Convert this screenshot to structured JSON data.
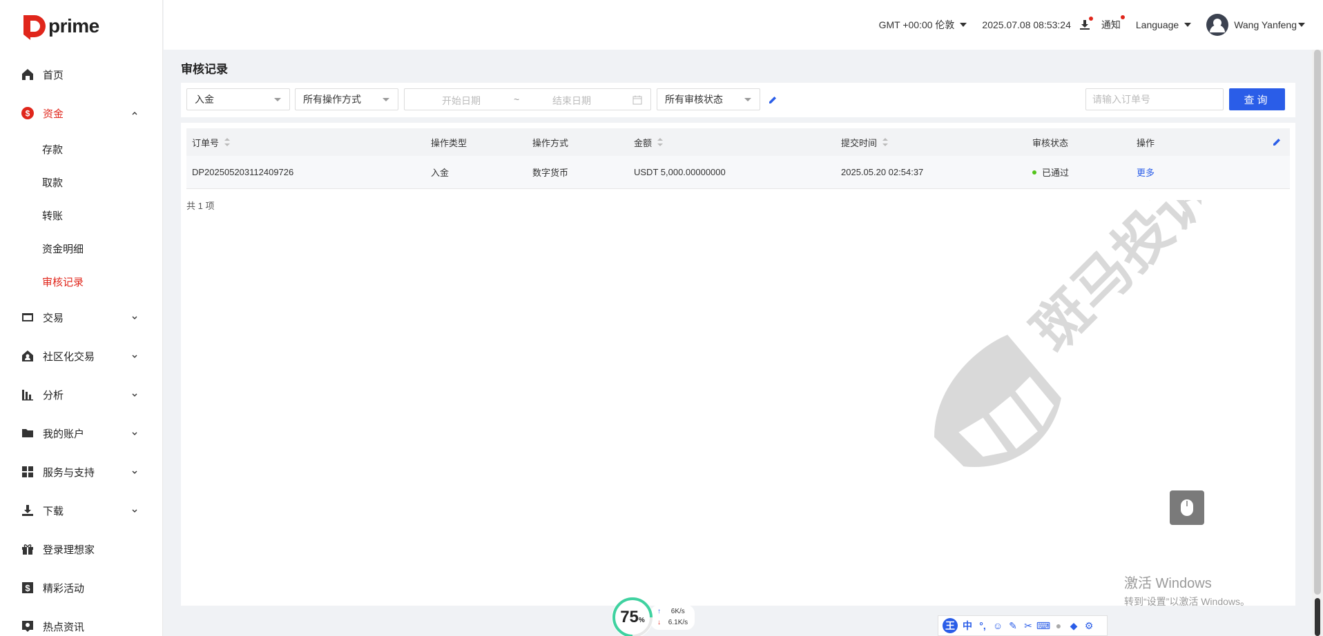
{
  "brand": {
    "name": "prime",
    "accent": "#e0261b"
  },
  "sidebar": {
    "items": [
      {
        "label": "首页",
        "icon": "home-icon"
      },
      {
        "label": "资金",
        "icon": "dollar-icon",
        "expanded": true,
        "children": [
          {
            "label": "存款"
          },
          {
            "label": "取款"
          },
          {
            "label": "转账"
          },
          {
            "label": "资金明细"
          },
          {
            "label": "审核记录",
            "active": true
          }
        ]
      },
      {
        "label": "交易",
        "icon": "card-icon"
      },
      {
        "label": "社区化交易",
        "icon": "community-icon"
      },
      {
        "label": "分析",
        "icon": "bar-chart-icon"
      },
      {
        "label": "我的账户",
        "icon": "folder-icon"
      },
      {
        "label": "服务与支持",
        "icon": "grid-icon"
      },
      {
        "label": "下载",
        "icon": "download-icon"
      },
      {
        "label": "登录理想家",
        "icon": "gift-icon"
      },
      {
        "label": "精彩活动",
        "icon": "dollar-box-icon"
      },
      {
        "label": "热点资讯",
        "icon": "location-icon"
      }
    ]
  },
  "header": {
    "timezone": "GMT +00:00 伦敦",
    "datetime": "2025.07.08 08:53:24",
    "notify": "通知",
    "language": "Language",
    "user": "Wang Yanfeng"
  },
  "page": {
    "title": "审核记录"
  },
  "filters": {
    "type": "入金",
    "method": "所有操作方式",
    "start_placeholder": "开始日期",
    "range_sep": "~",
    "end_placeholder": "结束日期",
    "status": "所有审核状态",
    "order_placeholder": "请输入订单号",
    "query_label": "查询"
  },
  "table": {
    "headers": [
      "订单号",
      "操作类型",
      "操作方式",
      "金额",
      "提交时间",
      "审核状态",
      "操作"
    ],
    "rows": [
      {
        "order": "DP202505203112409726",
        "type": "入金",
        "method": "数字货币",
        "amount": "USDT 5,000.00000000",
        "time": "2025.05.20 02:54:37",
        "status": "已通过",
        "action": "更多"
      }
    ],
    "total": "共 1 项"
  },
  "watermark": {
    "text": "斑马投诉"
  },
  "windows": {
    "line1": "激活 Windows",
    "line2": "转到“设置”以激活 Windows。"
  },
  "speed": {
    "percent": "75",
    "unit": "%",
    "up": "6",
    "up_unit": "K/s",
    "down": "6.1",
    "down_unit": "K/s"
  },
  "ime": {
    "mode": "中"
  }
}
